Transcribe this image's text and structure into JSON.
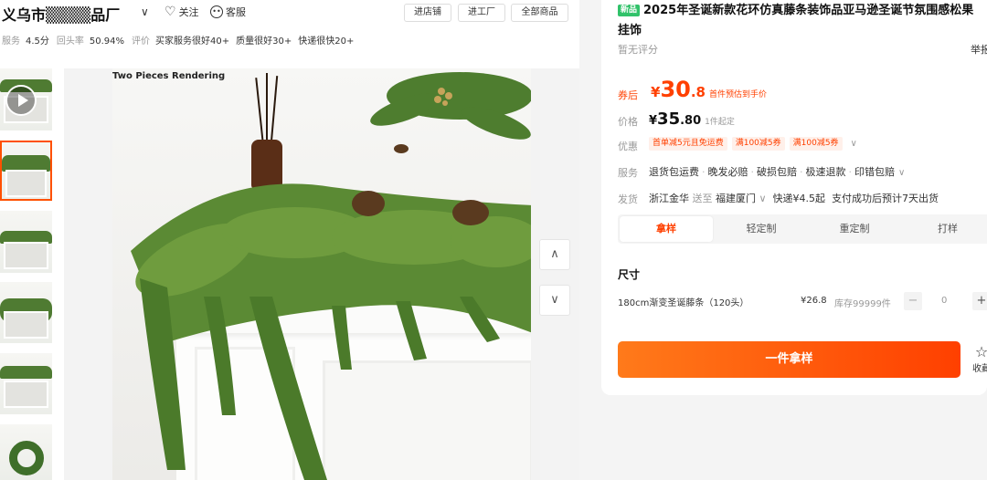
{
  "shop": {
    "name": "义乌市▒▒▒▒品厂",
    "follow_label": "关注",
    "service_label": "客服",
    "buttons": [
      "进店铺",
      "进工厂",
      "全部商品"
    ],
    "stats": {
      "service_label": "服务",
      "service_value": "4.5分",
      "repurchase_label": "回头率",
      "repurchase_value": "50.94%",
      "review_label": "评价",
      "tags": [
        "买家服务很好40+",
        "质量很好30+",
        "快递很快20+"
      ]
    }
  },
  "gallery": {
    "caption": "Two Pieces Rendering",
    "thumbnail_count": 6,
    "nav_up_icon": "chevron-up-icon",
    "nav_down_icon": "chevron-down-icon"
  },
  "product": {
    "badge": "新品",
    "title_line1": "2025年圣诞新款花环仿真藤条装饰品亚马逊圣诞节氛围感松果",
    "title_line2": "挂饰",
    "rating": "暂无评分",
    "report": "举报",
    "coupon_label": "券后",
    "coupon_price": {
      "currency": "¥",
      "int": "30",
      "dec": ".8",
      "note": "首件预估到手价"
    },
    "price_label": "价格",
    "price": {
      "currency": "¥",
      "int": "35",
      "dec": ".80",
      "moq": "1件起定"
    },
    "promo_label": "优惠",
    "promos": [
      "首单减5元且免运费",
      "满100减5券",
      "满100减5券"
    ],
    "service_label": "服务",
    "services": [
      "退货包运费",
      "晚发必赔",
      "破损包赔",
      "极速退款",
      "印错包赔"
    ],
    "ship_label": "发货",
    "ship": {
      "from": "浙江金华",
      "to_word": "送至",
      "to": "福建厦门",
      "fee": "快递¥4.5起",
      "eta": "支付成功后预计7天出货"
    },
    "tabs": [
      "拿样",
      "轻定制",
      "重定制",
      "打样"
    ],
    "active_tab": 0,
    "size_title": "尺寸",
    "sku": {
      "name": "180cm渐变圣诞藤条（120头）",
      "price": "¥26.8",
      "stock": "库存99999件",
      "qty": "0"
    },
    "buy_label": "一件拿样",
    "fav_label": "收藏"
  },
  "colors": {
    "accent": "#ff4000",
    "badge_green": "#31c26a",
    "selected_border": "#ff5000"
  }
}
